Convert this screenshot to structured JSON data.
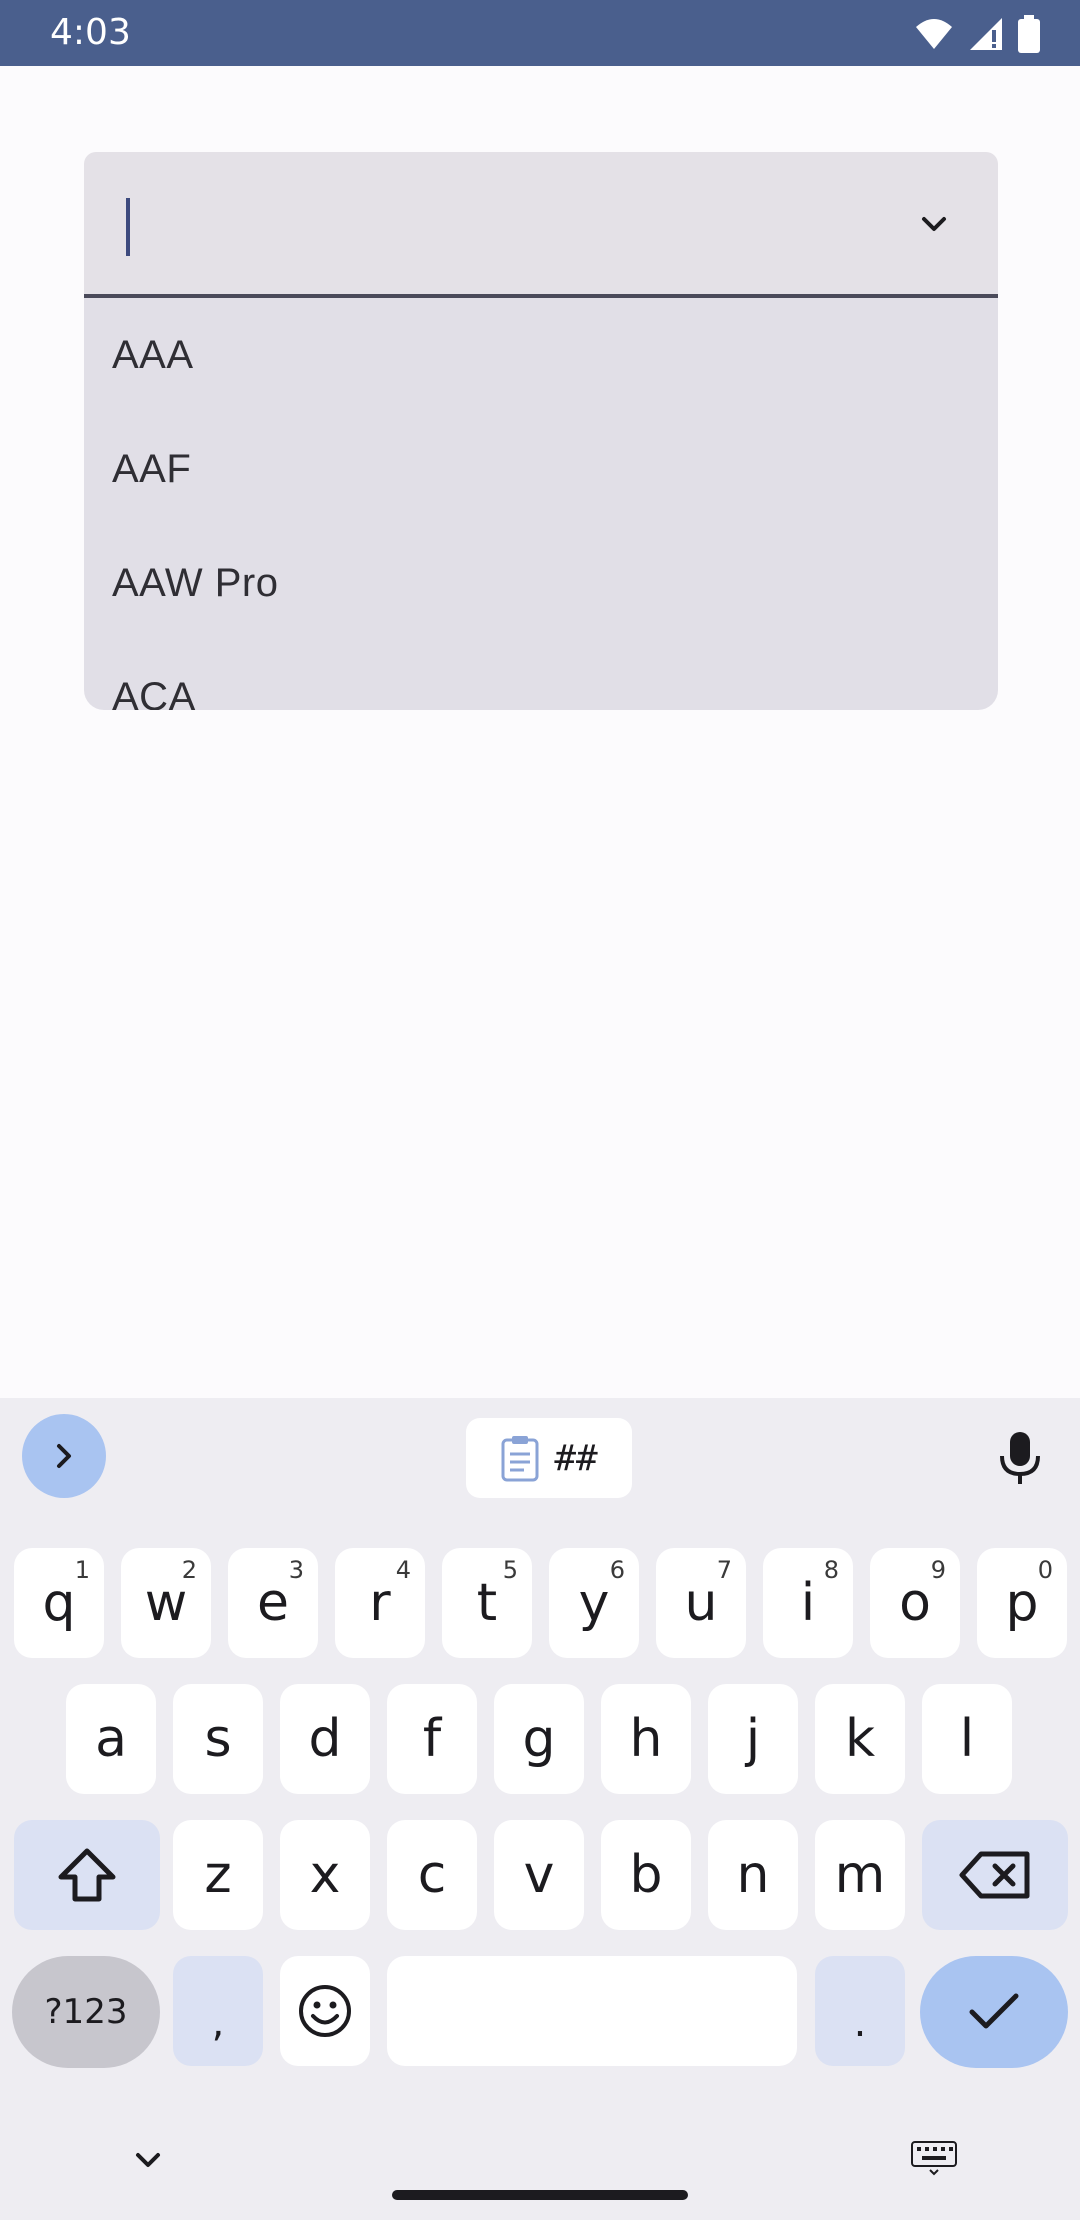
{
  "status_bar": {
    "time": "4:03",
    "icons": [
      "wifi-icon",
      "signal-icon",
      "battery-icon"
    ],
    "color": "#4a5f8d"
  },
  "combo": {
    "value": "",
    "options": [
      "AAA",
      "AAF",
      "AAW Pro",
      "ACA"
    ]
  },
  "keyboard": {
    "clipboard_chip": "##",
    "row1": [
      {
        "label": "q",
        "hint": "1"
      },
      {
        "label": "w",
        "hint": "2"
      },
      {
        "label": "e",
        "hint": "3"
      },
      {
        "label": "r",
        "hint": "4"
      },
      {
        "label": "t",
        "hint": "5"
      },
      {
        "label": "y",
        "hint": "6"
      },
      {
        "label": "u",
        "hint": "7"
      },
      {
        "label": "i",
        "hint": "8"
      },
      {
        "label": "o",
        "hint": "9"
      },
      {
        "label": "p",
        "hint": "0"
      }
    ],
    "row2": [
      "a",
      "s",
      "d",
      "f",
      "g",
      "h",
      "j",
      "k",
      "l"
    ],
    "row3": [
      "z",
      "x",
      "c",
      "v",
      "b",
      "n",
      "m"
    ],
    "symbols_label": "?123",
    "comma_label": ",",
    "period_label": ".",
    "accent_color": "#a9c4f1"
  }
}
